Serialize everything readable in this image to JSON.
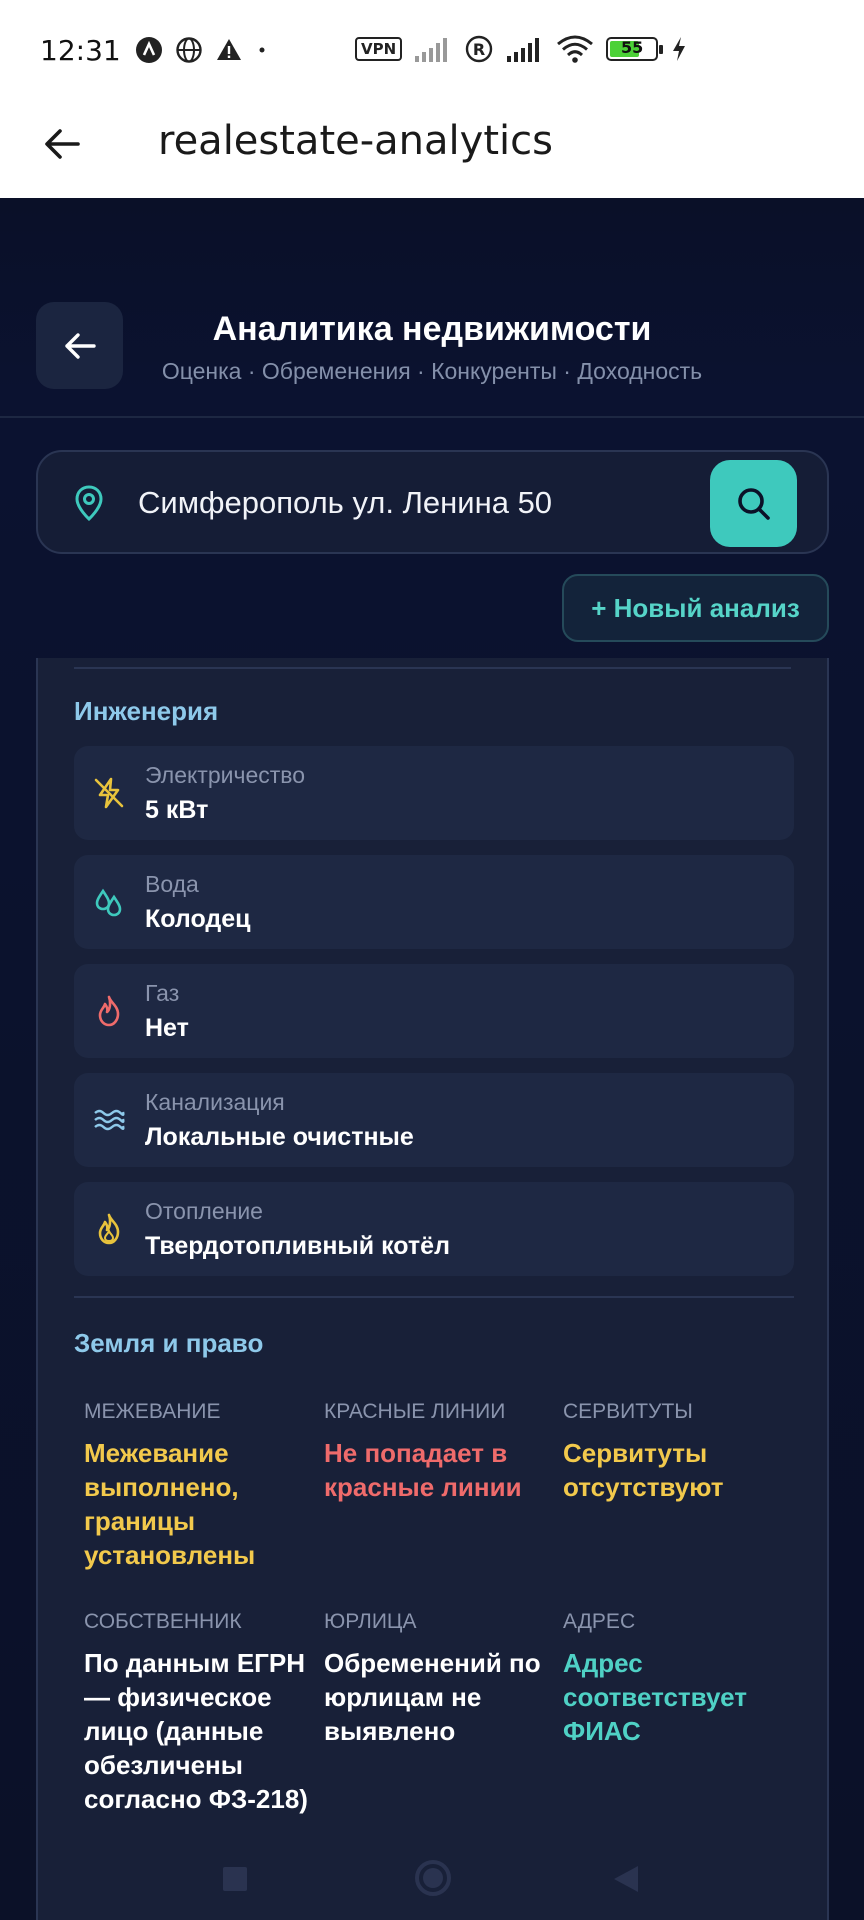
{
  "status_bar": {
    "time": "12:31",
    "vpn_label": "VPN",
    "battery_level": "55"
  },
  "app_bar": {
    "title": "realestate-analytics"
  },
  "header": {
    "title": "Аналитика недвижимости",
    "subtitle": "Оценка · Обременения · Конкуренты · Доходность"
  },
  "search": {
    "value": "Симферополь ул. Ленина 50"
  },
  "new_analysis_button": "+ Новый анализ",
  "engineering": {
    "title": "Инженерия",
    "items": [
      {
        "label": "Электричество",
        "value": "5 кВт",
        "icon": "lightning-off-icon",
        "color": "#e8c33c"
      },
      {
        "label": "Вода",
        "value": "Колодец",
        "icon": "droplets-icon",
        "color": "#3ec9bd"
      },
      {
        "label": "Газ",
        "value": "Нет",
        "icon": "flame-icon",
        "color": "#ef6b6b"
      },
      {
        "label": "Канализация",
        "value": "Локальные очистные",
        "icon": "waves-icon",
        "color": "#8ec9ea"
      },
      {
        "label": "Отопление",
        "value": "Твердотопливный котёл",
        "icon": "fire-icon",
        "color": "#e8c33c"
      }
    ]
  },
  "land_law": {
    "title": "Земля и право",
    "cells": [
      {
        "head": "Межевание",
        "value": "Межевание выполнено, границы установлены",
        "color": "#f2c94c"
      },
      {
        "head": "Красные линии",
        "value": "Не попадает в красные линии",
        "color": "#ef6b6b"
      },
      {
        "head": "Сервитуты",
        "value": "Сервитуты отсутствуют",
        "color": "#f2c94c"
      },
      {
        "head": "Собственник",
        "value": "По данным ЕГРН — физическое лицо (данные обезличены согласно ФЗ-218)",
        "color": "#ffffff"
      },
      {
        "head": "Юрлица",
        "value": "Обременений по юрлицам не выявлено",
        "color": "#ffffff"
      },
      {
        "head": "Адрес",
        "value": "Адрес соответствует ФИАС",
        "color": "#4fd1c5"
      }
    ]
  }
}
